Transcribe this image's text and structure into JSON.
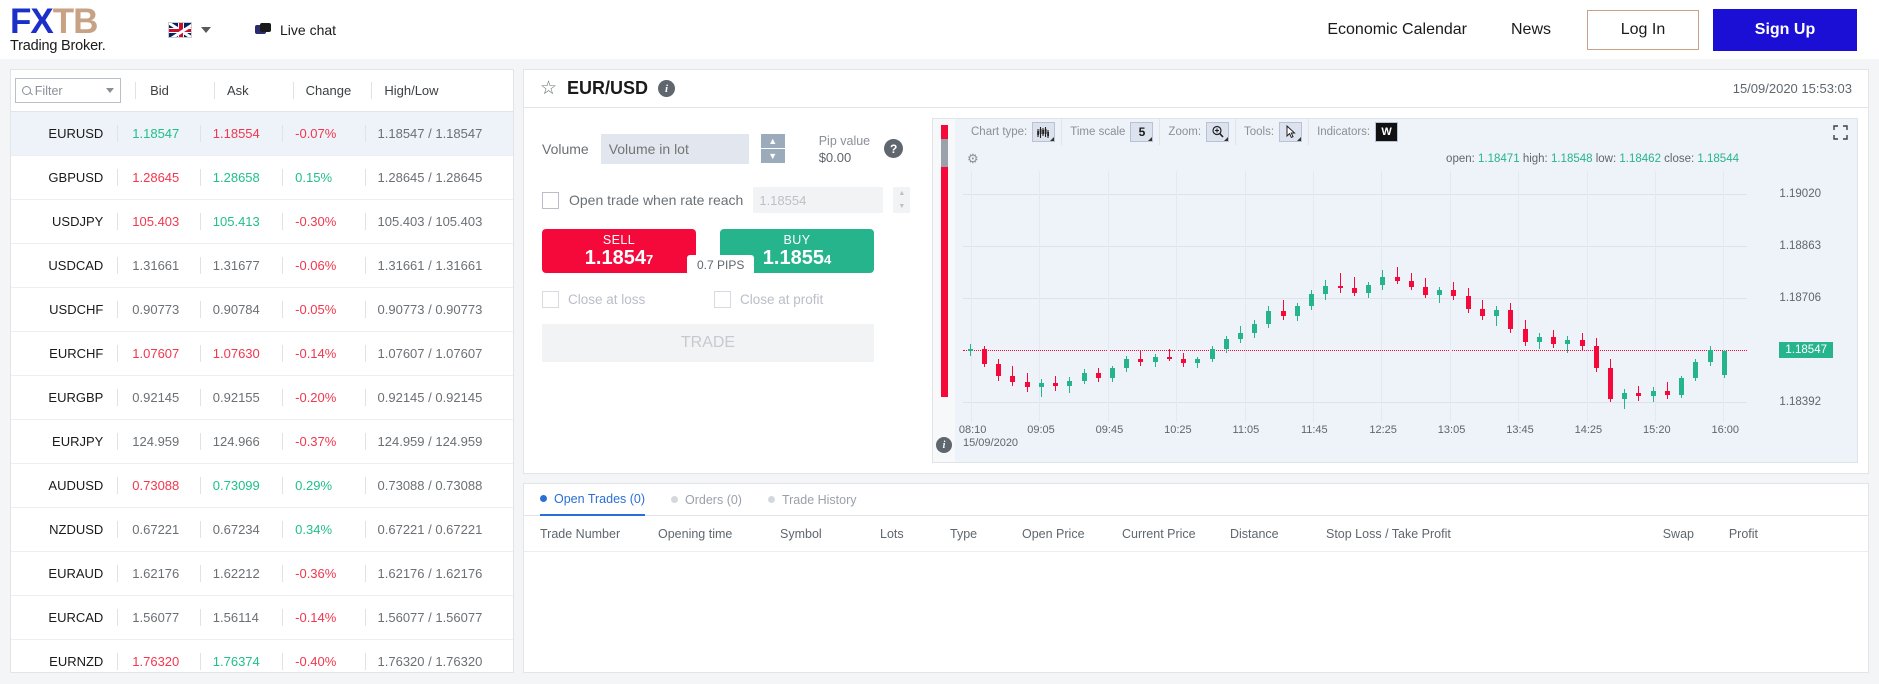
{
  "header": {
    "logo_fx": "FX",
    "logo_tb": "TB",
    "logo_sub": "Trading Broker.",
    "flag_icon": "uk-flag-icon",
    "live_chat": "Live chat",
    "economic_calendar": "Economic Calendar",
    "news": "News",
    "log_in": "Log In",
    "sign_up": "Sign Up"
  },
  "quotes": {
    "filter_placeholder": "Filter",
    "columns": [
      "Bid",
      "Ask",
      "Change",
      "High/Low"
    ],
    "rows": [
      {
        "symbol": "EURUSD",
        "bid": "1.18547",
        "ask": "1.18554",
        "change": "-0.07%",
        "highlow": "1.18547 / 1.18547",
        "bid_dir": "up",
        "ask_dir": "down",
        "chg_dir": "down",
        "active": true
      },
      {
        "symbol": "GBPUSD",
        "bid": "1.28645",
        "ask": "1.28658",
        "change": "0.15%",
        "highlow": "1.28645 / 1.28645",
        "bid_dir": "down",
        "ask_dir": "up",
        "chg_dir": "up",
        "active": false
      },
      {
        "symbol": "USDJPY",
        "bid": "105.403",
        "ask": "105.413",
        "change": "-0.30%",
        "highlow": "105.403 / 105.403",
        "bid_dir": "down",
        "ask_dir": "up",
        "chg_dir": "down",
        "active": false
      },
      {
        "symbol": "USDCAD",
        "bid": "1.31661",
        "ask": "1.31677",
        "change": "-0.06%",
        "highlow": "1.31661 / 1.31661",
        "bid_dir": "flat",
        "ask_dir": "flat",
        "chg_dir": "down",
        "active": false
      },
      {
        "symbol": "USDCHF",
        "bid": "0.90773",
        "ask": "0.90784",
        "change": "-0.05%",
        "highlow": "0.90773 / 0.90773",
        "bid_dir": "flat",
        "ask_dir": "flat",
        "chg_dir": "down",
        "active": false
      },
      {
        "symbol": "EURCHF",
        "bid": "1.07607",
        "ask": "1.07630",
        "change": "-0.14%",
        "highlow": "1.07607 / 1.07607",
        "bid_dir": "down",
        "ask_dir": "down",
        "chg_dir": "down",
        "active": false
      },
      {
        "symbol": "EURGBP",
        "bid": "0.92145",
        "ask": "0.92155",
        "change": "-0.20%",
        "highlow": "0.92145 / 0.92145",
        "bid_dir": "flat",
        "ask_dir": "flat",
        "chg_dir": "down",
        "active": false
      },
      {
        "symbol": "EURJPY",
        "bid": "124.959",
        "ask": "124.966",
        "change": "-0.37%",
        "highlow": "124.959 / 124.959",
        "bid_dir": "flat",
        "ask_dir": "flat",
        "chg_dir": "down",
        "active": false
      },
      {
        "symbol": "AUDUSD",
        "bid": "0.73088",
        "ask": "0.73099",
        "change": "0.29%",
        "highlow": "0.73088 / 0.73088",
        "bid_dir": "down",
        "ask_dir": "up",
        "chg_dir": "up",
        "active": false
      },
      {
        "symbol": "NZDUSD",
        "bid": "0.67221",
        "ask": "0.67234",
        "change": "0.34%",
        "highlow": "0.67221 / 0.67221",
        "bid_dir": "flat",
        "ask_dir": "flat",
        "chg_dir": "up",
        "active": false
      },
      {
        "symbol": "EURAUD",
        "bid": "1.62176",
        "ask": "1.62212",
        "change": "-0.36%",
        "highlow": "1.62176 / 1.62176",
        "bid_dir": "flat",
        "ask_dir": "flat",
        "chg_dir": "down",
        "active": false
      },
      {
        "symbol": "EURCAD",
        "bid": "1.56077",
        "ask": "1.56114",
        "change": "-0.14%",
        "highlow": "1.56077 / 1.56077",
        "bid_dir": "flat",
        "ask_dir": "flat",
        "chg_dir": "down",
        "active": false
      },
      {
        "symbol": "EURNZD",
        "bid": "1.76320",
        "ask": "1.76374",
        "change": "-0.40%",
        "highlow": "1.76320 / 1.76320",
        "bid_dir": "down",
        "ask_dir": "up",
        "chg_dir": "down",
        "active": false
      }
    ]
  },
  "instrument": {
    "name": "EUR/USD",
    "star_icon": "star-icon",
    "info_icon": "info-icon",
    "timestamp": "15/09/2020 15:53:03"
  },
  "trade": {
    "volume_label": "Volume",
    "volume_placeholder": "Volume in lot",
    "volume_value": "",
    "pip_value_label": "Pip value",
    "pip_value": "$0.00",
    "help_icon": "question-icon",
    "rate_reach_label": "Open trade when rate reach",
    "rate_reach_value": "1.18554",
    "sell_label": "SELL",
    "sell_price_main": "1.1854",
    "sell_price_sub": "7",
    "buy_label": "BUY",
    "buy_price_main": "1.1855",
    "buy_price_sub": "4",
    "pips_badge": "0.7 PIPS",
    "close_at_loss": "Close at loss",
    "close_at_profit": "Close at profit",
    "trade_button": "TRADE"
  },
  "chart_toolbar": {
    "chart_type_label": "Chart type:",
    "chart_type_icon": "candlestick-icon",
    "time_scale_label": "Time scale",
    "time_scale_value": "5",
    "zoom_label": "Zoom:",
    "zoom_icon": "magnifier-plus-icon",
    "tools_label": "Tools:",
    "tools_icon": "cursor-icon",
    "indicators_label": "Indicators:",
    "indicators_value": "W",
    "gear_icon": "gear-icon",
    "expand_icon": "expand-icon",
    "chart_info_icon": "info-icon"
  },
  "chart_data": {
    "type": "candlestick",
    "title": "EUR/USD",
    "ohlc_labels": {
      "open": "open:",
      "high": "high:",
      "low": "low:",
      "close": "close:"
    },
    "ohlc_values": {
      "open": "1.18471",
      "high": "1.18548",
      "low": "1.18462",
      "close": "1.18544"
    },
    "y_ticks": [
      "1.19020",
      "1.18863",
      "1.18706",
      "1.18392"
    ],
    "current_price_badge": "1.18547",
    "ylim": [
      1.1833,
      1.1909
    ],
    "x_ticks": [
      "08:10",
      "09:05",
      "09:45",
      "10:25",
      "11:05",
      "11:45",
      "12:25",
      "13:05",
      "13:45",
      "14:25",
      "15:20",
      "16:00"
    ],
    "x_date": "15/09/2020",
    "candles": [
      {
        "o": 1.18545,
        "h": 1.18565,
        "l": 1.1853,
        "c": 1.18552,
        "d": "up"
      },
      {
        "o": 1.18552,
        "h": 1.1856,
        "l": 1.18495,
        "c": 1.18505,
        "d": "down"
      },
      {
        "o": 1.18505,
        "h": 1.1852,
        "l": 1.18455,
        "c": 1.1847,
        "d": "down"
      },
      {
        "o": 1.1847,
        "h": 1.185,
        "l": 1.1844,
        "c": 1.18452,
        "d": "down"
      },
      {
        "o": 1.18452,
        "h": 1.18478,
        "l": 1.1842,
        "c": 1.18435,
        "d": "down"
      },
      {
        "o": 1.18435,
        "h": 1.1846,
        "l": 1.18405,
        "c": 1.18448,
        "d": "up"
      },
      {
        "o": 1.18448,
        "h": 1.1847,
        "l": 1.18425,
        "c": 1.18438,
        "d": "down"
      },
      {
        "o": 1.18438,
        "h": 1.18465,
        "l": 1.18418,
        "c": 1.18455,
        "d": "up"
      },
      {
        "o": 1.18455,
        "h": 1.1849,
        "l": 1.18445,
        "c": 1.18478,
        "d": "up"
      },
      {
        "o": 1.18478,
        "h": 1.18495,
        "l": 1.1845,
        "c": 1.18462,
        "d": "down"
      },
      {
        "o": 1.18462,
        "h": 1.185,
        "l": 1.18452,
        "c": 1.18492,
        "d": "up"
      },
      {
        "o": 1.18492,
        "h": 1.1853,
        "l": 1.1848,
        "c": 1.1852,
        "d": "up"
      },
      {
        "o": 1.1852,
        "h": 1.18545,
        "l": 1.185,
        "c": 1.18512,
        "d": "down"
      },
      {
        "o": 1.18512,
        "h": 1.18535,
        "l": 1.18495,
        "c": 1.18528,
        "d": "up"
      },
      {
        "o": 1.18528,
        "h": 1.18552,
        "l": 1.18515,
        "c": 1.1852,
        "d": "down"
      },
      {
        "o": 1.1852,
        "h": 1.1854,
        "l": 1.18498,
        "c": 1.18508,
        "d": "down"
      },
      {
        "o": 1.18508,
        "h": 1.18528,
        "l": 1.18492,
        "c": 1.18522,
        "d": "up"
      },
      {
        "o": 1.18522,
        "h": 1.1856,
        "l": 1.18512,
        "c": 1.1855,
        "d": "up"
      },
      {
        "o": 1.1855,
        "h": 1.1859,
        "l": 1.1854,
        "c": 1.18582,
        "d": "up"
      },
      {
        "o": 1.18582,
        "h": 1.1862,
        "l": 1.1857,
        "c": 1.186,
        "d": "up"
      },
      {
        "o": 1.186,
        "h": 1.1864,
        "l": 1.18585,
        "c": 1.18628,
        "d": "up"
      },
      {
        "o": 1.18628,
        "h": 1.1868,
        "l": 1.18615,
        "c": 1.18665,
        "d": "up"
      },
      {
        "o": 1.18665,
        "h": 1.187,
        "l": 1.1864,
        "c": 1.18652,
        "d": "down"
      },
      {
        "o": 1.18652,
        "h": 1.1869,
        "l": 1.18635,
        "c": 1.1868,
        "d": "up"
      },
      {
        "o": 1.1868,
        "h": 1.1873,
        "l": 1.18668,
        "c": 1.18718,
        "d": "up"
      },
      {
        "o": 1.18718,
        "h": 1.1876,
        "l": 1.187,
        "c": 1.18742,
        "d": "up"
      },
      {
        "o": 1.18742,
        "h": 1.1878,
        "l": 1.1872,
        "c": 1.18735,
        "d": "down"
      },
      {
        "o": 1.18735,
        "h": 1.18768,
        "l": 1.1871,
        "c": 1.18722,
        "d": "down"
      },
      {
        "o": 1.18722,
        "h": 1.18755,
        "l": 1.18705,
        "c": 1.18745,
        "d": "up"
      },
      {
        "o": 1.18745,
        "h": 1.1879,
        "l": 1.1873,
        "c": 1.1877,
        "d": "up"
      },
      {
        "o": 1.1877,
        "h": 1.188,
        "l": 1.18748,
        "c": 1.18758,
        "d": "down"
      },
      {
        "o": 1.18758,
        "h": 1.18782,
        "l": 1.1873,
        "c": 1.1874,
        "d": "down"
      },
      {
        "o": 1.1874,
        "h": 1.18765,
        "l": 1.18705,
        "c": 1.18715,
        "d": "down"
      },
      {
        "o": 1.18715,
        "h": 1.1874,
        "l": 1.1869,
        "c": 1.1873,
        "d": "up"
      },
      {
        "o": 1.1873,
        "h": 1.18755,
        "l": 1.187,
        "c": 1.18712,
        "d": "down"
      },
      {
        "o": 1.18712,
        "h": 1.18735,
        "l": 1.1866,
        "c": 1.18672,
        "d": "down"
      },
      {
        "o": 1.18672,
        "h": 1.187,
        "l": 1.1864,
        "c": 1.18652,
        "d": "down"
      },
      {
        "o": 1.18652,
        "h": 1.1868,
        "l": 1.1862,
        "c": 1.18668,
        "d": "up"
      },
      {
        "o": 1.18668,
        "h": 1.1869,
        "l": 1.186,
        "c": 1.18612,
        "d": "down"
      },
      {
        "o": 1.18612,
        "h": 1.1864,
        "l": 1.1856,
        "c": 1.18572,
        "d": "down"
      },
      {
        "o": 1.18572,
        "h": 1.186,
        "l": 1.1855,
        "c": 1.18588,
        "d": "up"
      },
      {
        "o": 1.18588,
        "h": 1.1861,
        "l": 1.18555,
        "c": 1.18565,
        "d": "down"
      },
      {
        "o": 1.18565,
        "h": 1.1859,
        "l": 1.1854,
        "c": 1.18578,
        "d": "up"
      },
      {
        "o": 1.18578,
        "h": 1.186,
        "l": 1.18548,
        "c": 1.1856,
        "d": "down"
      },
      {
        "o": 1.1856,
        "h": 1.18585,
        "l": 1.1848,
        "c": 1.18492,
        "d": "down"
      },
      {
        "o": 1.18492,
        "h": 1.1852,
        "l": 1.1839,
        "c": 1.184,
        "d": "down"
      },
      {
        "o": 1.184,
        "h": 1.1843,
        "l": 1.1837,
        "c": 1.18418,
        "d": "up"
      },
      {
        "o": 1.18418,
        "h": 1.1844,
        "l": 1.18395,
        "c": 1.18408,
        "d": "down"
      },
      {
        "o": 1.18408,
        "h": 1.18435,
        "l": 1.1839,
        "c": 1.18425,
        "d": "up"
      },
      {
        "o": 1.18425,
        "h": 1.1845,
        "l": 1.184,
        "c": 1.18412,
        "d": "down"
      },
      {
        "o": 1.18412,
        "h": 1.1847,
        "l": 1.18402,
        "c": 1.18462,
        "d": "up"
      },
      {
        "o": 1.18462,
        "h": 1.1852,
        "l": 1.18455,
        "c": 1.18512,
        "d": "up"
      },
      {
        "o": 1.18512,
        "h": 1.1856,
        "l": 1.185,
        "c": 1.18548,
        "d": "up"
      },
      {
        "o": 1.18471,
        "h": 1.18548,
        "l": 1.18462,
        "c": 1.18544,
        "d": "up"
      }
    ]
  },
  "bottom": {
    "tabs": [
      {
        "label": "Open Trades (0)",
        "active": true
      },
      {
        "label": "Orders (0)",
        "active": false
      },
      {
        "label": "Trade History",
        "active": false
      }
    ],
    "columns": [
      "Trade Number",
      "Opening time",
      "Symbol",
      "Lots",
      "Type",
      "Open Price",
      "Current Price",
      "Distance",
      "Stop Loss / Take Profit",
      "Swap",
      "Profit"
    ]
  }
}
